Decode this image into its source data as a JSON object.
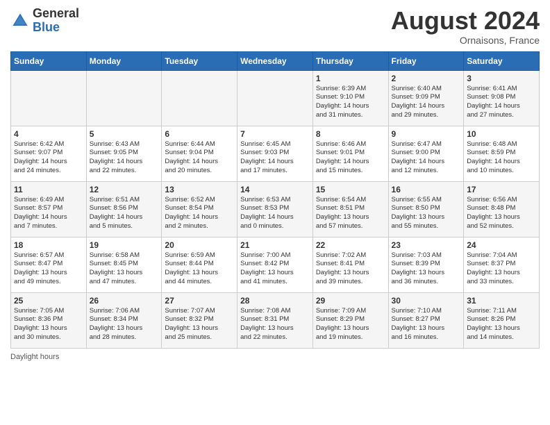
{
  "header": {
    "logo_general": "General",
    "logo_blue": "Blue",
    "title": "August 2024",
    "subtitle": "Ornaisons, France"
  },
  "days_of_week": [
    "Sunday",
    "Monday",
    "Tuesday",
    "Wednesday",
    "Thursday",
    "Friday",
    "Saturday"
  ],
  "weeks": [
    [
      {
        "day": "",
        "info": ""
      },
      {
        "day": "",
        "info": ""
      },
      {
        "day": "",
        "info": ""
      },
      {
        "day": "",
        "info": ""
      },
      {
        "day": "1",
        "info": "Sunrise: 6:39 AM\nSunset: 9:10 PM\nDaylight: 14 hours\nand 31 minutes."
      },
      {
        "day": "2",
        "info": "Sunrise: 6:40 AM\nSunset: 9:09 PM\nDaylight: 14 hours\nand 29 minutes."
      },
      {
        "day": "3",
        "info": "Sunrise: 6:41 AM\nSunset: 9:08 PM\nDaylight: 14 hours\nand 27 minutes."
      }
    ],
    [
      {
        "day": "4",
        "info": "Sunrise: 6:42 AM\nSunset: 9:07 PM\nDaylight: 14 hours\nand 24 minutes."
      },
      {
        "day": "5",
        "info": "Sunrise: 6:43 AM\nSunset: 9:05 PM\nDaylight: 14 hours\nand 22 minutes."
      },
      {
        "day": "6",
        "info": "Sunrise: 6:44 AM\nSunset: 9:04 PM\nDaylight: 14 hours\nand 20 minutes."
      },
      {
        "day": "7",
        "info": "Sunrise: 6:45 AM\nSunset: 9:03 PM\nDaylight: 14 hours\nand 17 minutes."
      },
      {
        "day": "8",
        "info": "Sunrise: 6:46 AM\nSunset: 9:01 PM\nDaylight: 14 hours\nand 15 minutes."
      },
      {
        "day": "9",
        "info": "Sunrise: 6:47 AM\nSunset: 9:00 PM\nDaylight: 14 hours\nand 12 minutes."
      },
      {
        "day": "10",
        "info": "Sunrise: 6:48 AM\nSunset: 8:59 PM\nDaylight: 14 hours\nand 10 minutes."
      }
    ],
    [
      {
        "day": "11",
        "info": "Sunrise: 6:49 AM\nSunset: 8:57 PM\nDaylight: 14 hours\nand 7 minutes."
      },
      {
        "day": "12",
        "info": "Sunrise: 6:51 AM\nSunset: 8:56 PM\nDaylight: 14 hours\nand 5 minutes."
      },
      {
        "day": "13",
        "info": "Sunrise: 6:52 AM\nSunset: 8:54 PM\nDaylight: 14 hours\nand 2 minutes."
      },
      {
        "day": "14",
        "info": "Sunrise: 6:53 AM\nSunset: 8:53 PM\nDaylight: 14 hours\nand 0 minutes."
      },
      {
        "day": "15",
        "info": "Sunrise: 6:54 AM\nSunset: 8:51 PM\nDaylight: 13 hours\nand 57 minutes."
      },
      {
        "day": "16",
        "info": "Sunrise: 6:55 AM\nSunset: 8:50 PM\nDaylight: 13 hours\nand 55 minutes."
      },
      {
        "day": "17",
        "info": "Sunrise: 6:56 AM\nSunset: 8:48 PM\nDaylight: 13 hours\nand 52 minutes."
      }
    ],
    [
      {
        "day": "18",
        "info": "Sunrise: 6:57 AM\nSunset: 8:47 PM\nDaylight: 13 hours\nand 49 minutes."
      },
      {
        "day": "19",
        "info": "Sunrise: 6:58 AM\nSunset: 8:45 PM\nDaylight: 13 hours\nand 47 minutes."
      },
      {
        "day": "20",
        "info": "Sunrise: 6:59 AM\nSunset: 8:44 PM\nDaylight: 13 hours\nand 44 minutes."
      },
      {
        "day": "21",
        "info": "Sunrise: 7:00 AM\nSunset: 8:42 PM\nDaylight: 13 hours\nand 41 minutes."
      },
      {
        "day": "22",
        "info": "Sunrise: 7:02 AM\nSunset: 8:41 PM\nDaylight: 13 hours\nand 39 minutes."
      },
      {
        "day": "23",
        "info": "Sunrise: 7:03 AM\nSunset: 8:39 PM\nDaylight: 13 hours\nand 36 minutes."
      },
      {
        "day": "24",
        "info": "Sunrise: 7:04 AM\nSunset: 8:37 PM\nDaylight: 13 hours\nand 33 minutes."
      }
    ],
    [
      {
        "day": "25",
        "info": "Sunrise: 7:05 AM\nSunset: 8:36 PM\nDaylight: 13 hours\nand 30 minutes."
      },
      {
        "day": "26",
        "info": "Sunrise: 7:06 AM\nSunset: 8:34 PM\nDaylight: 13 hours\nand 28 minutes."
      },
      {
        "day": "27",
        "info": "Sunrise: 7:07 AM\nSunset: 8:32 PM\nDaylight: 13 hours\nand 25 minutes."
      },
      {
        "day": "28",
        "info": "Sunrise: 7:08 AM\nSunset: 8:31 PM\nDaylight: 13 hours\nand 22 minutes."
      },
      {
        "day": "29",
        "info": "Sunrise: 7:09 AM\nSunset: 8:29 PM\nDaylight: 13 hours\nand 19 minutes."
      },
      {
        "day": "30",
        "info": "Sunrise: 7:10 AM\nSunset: 8:27 PM\nDaylight: 13 hours\nand 16 minutes."
      },
      {
        "day": "31",
        "info": "Sunrise: 7:11 AM\nSunset: 8:26 PM\nDaylight: 13 hours\nand 14 minutes."
      }
    ]
  ],
  "footer": {
    "daylight_label": "Daylight hours"
  }
}
